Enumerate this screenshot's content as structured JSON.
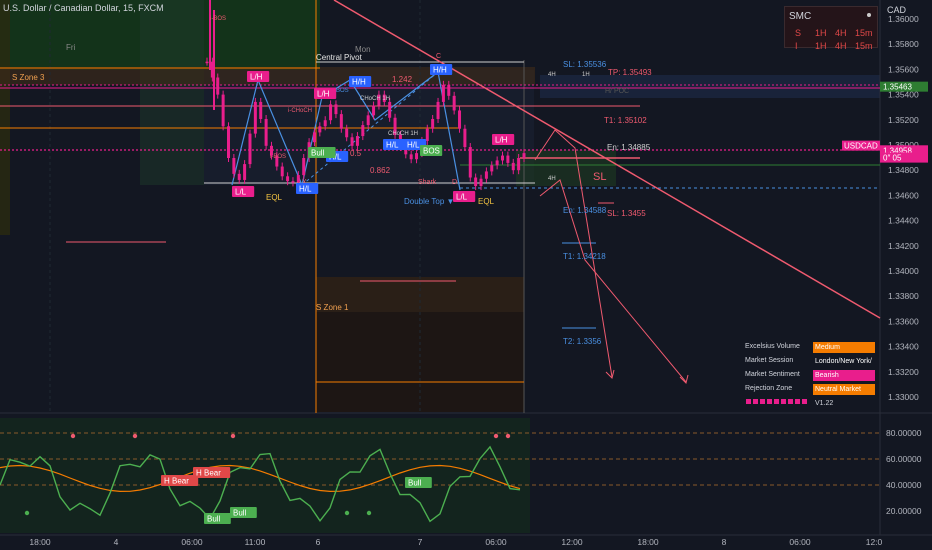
{
  "header": {
    "symbol_title": "U.S. Dollar / Canadian Dollar, 15, FXCM"
  },
  "currency": "CAD",
  "colors": {
    "background": "#131722",
    "bull": "#e91e8c",
    "bear": "#e91e8c",
    "trendline": "#ef5a6f",
    "zone_green": "#1b5e20",
    "zone_orange": "#f57c00",
    "structure": "#4a90e2",
    "pivot": "#cfcfcf"
  },
  "price_axis": {
    "ticks": [
      "1.36000",
      "1.35800",
      "1.35600",
      "1.35400",
      "1.35200",
      "1.35000",
      "1.34800",
      "1.34600",
      "1.34400",
      "1.34200",
      "1.34000",
      "1.33800",
      "1.33600",
      "1.33400",
      "1.33200",
      "1.33000"
    ],
    "badges": [
      {
        "text": "1.35463",
        "color": "#2e7d32",
        "price": 1.35463
      },
      {
        "text": "USDCAD",
        "color": "#e91e8c",
        "price": 1.34995
      },
      {
        "text": "1.34958",
        "color": "#e91e8c",
        "price": 1.34958
      },
      {
        "text": "0″ 05",
        "color": "#e91e8c",
        "price": 1.349
      }
    ]
  },
  "time_axis": {
    "labels": [
      "18:00",
      "4",
      "06:00",
      "11:00",
      "6",
      "7",
      "06:00",
      "12:00",
      "18:00",
      "8",
      "06:00",
      "12:0"
    ]
  },
  "smc_panel": {
    "title": "SMC",
    "rows": [
      {
        "col0": "S",
        "col1": "1H",
        "col2": "4H",
        "col3": "15m"
      },
      {
        "col0": "I",
        "col1": "1H",
        "col2": "4H",
        "col3": "15m"
      }
    ]
  },
  "annotations": {
    "zone3": "S Zone 3",
    "zone1": "S Zone 1",
    "central_pivot": "Central Pivot",
    "fri": "Fri",
    "mon": "Mon",
    "eql_left": "EQL",
    "eql_right": "EQL",
    "double_top": "Double Top ▼",
    "ll_left": "L/L",
    "hl_left": "H/L",
    "lh_left": "L/H",
    "lh_mid": "L/H",
    "hh_mid": "H/H",
    "hh_right": "H/H",
    "hl_mid": "H/L",
    "hl_mid2": "H/L",
    "ll_right": "L/L",
    "lh_right": "L/H",
    "bull_tag": "Bull",
    "bos_tag": "BOS",
    "fib_1242": "1.242",
    "fib_0862": "0.862",
    "fib_05": "0.5",
    "choch": "CHoCH 1H",
    "sl_top": "SL: 1.35536",
    "tp_top": "TP: 1.35493",
    "t1_top": "T1: 1.35102",
    "entry_top": "En: 1.34885",
    "sl_label": "SL",
    "en_bottom": "En: 1.34588",
    "sl_bottom": "SL: 1.3455",
    "t1_bottom": "T1: 1.34218",
    "t2_bottom": "T2: 1.3356",
    "tf_4h": "4H",
    "tf_1h": "1H",
    "tf_4h2": "4H",
    "shark": "Shark",
    "c_label": "C",
    "d_label": "D",
    "x_label": "X",
    "ibos": "i-BOS",
    "bos": "BOS",
    "ichoch": "i-CHoCH",
    "hpd": "H/ POC"
  },
  "info_table": [
    {
      "icon": "flame",
      "label": "Excelsius Volume",
      "value": "Medium",
      "bg": "#f57c00"
    },
    {
      "icon": "clock",
      "label": "Market Session",
      "value": "London/New York/",
      "bg": "transparent"
    },
    {
      "icon": "bar-chart",
      "label": "Market Sentiment",
      "value": "Bearish",
      "bg": "#e91e8c"
    },
    {
      "icon": "wave",
      "label": "Rejection Zone",
      "value": "Neutral Market",
      "bg": "#f57c00"
    }
  ],
  "info_version": "V1.22",
  "oscillator": {
    "axis_ticks": [
      "80.00000",
      "60.00000",
      "40.00000",
      "20.00000"
    ],
    "labels": {
      "h_bear1": "H Bear",
      "h_bear2": "H Bear",
      "bull1": "Bull",
      "bull2": "Bull",
      "bull3": "Bull"
    }
  },
  "chart_data": {
    "type": "line",
    "series": [
      {
        "values": [
          1.3575,
          1.3562,
          1.3548,
          1.3522,
          1.3496,
          1.3483,
          1.3478,
          1.3491,
          1.3516,
          1.3542,
          1.3528,
          1.3506,
          1.3498,
          1.3489,
          1.3481,
          1.3477,
          1.3476,
          1.3482,
          1.3496,
          1.3509,
          1.3517,
          1.3522,
          1.3527,
          1.354,
          1.3532,
          1.352,
          1.3513,
          1.3506,
          1.3514,
          1.3523,
          1.3531,
          1.3539,
          1.3548,
          1.3542,
          1.3529,
          1.3515,
          1.3505,
          1.3499,
          1.3495,
          1.35,
          1.351,
          1.352,
          1.3528,
          1.3542,
          1.3556,
          1.3547,
          1.3535,
          1.352,
          1.3505,
          1.348,
          1.3473,
          1.3479,
          1.3485,
          1.349,
          1.3494,
          1.3498,
          1.3492,
          1.3486,
          1.3496,
          1.35
        ]
      }
    ],
    "ylim": [
      1.33,
      1.361
    ]
  }
}
